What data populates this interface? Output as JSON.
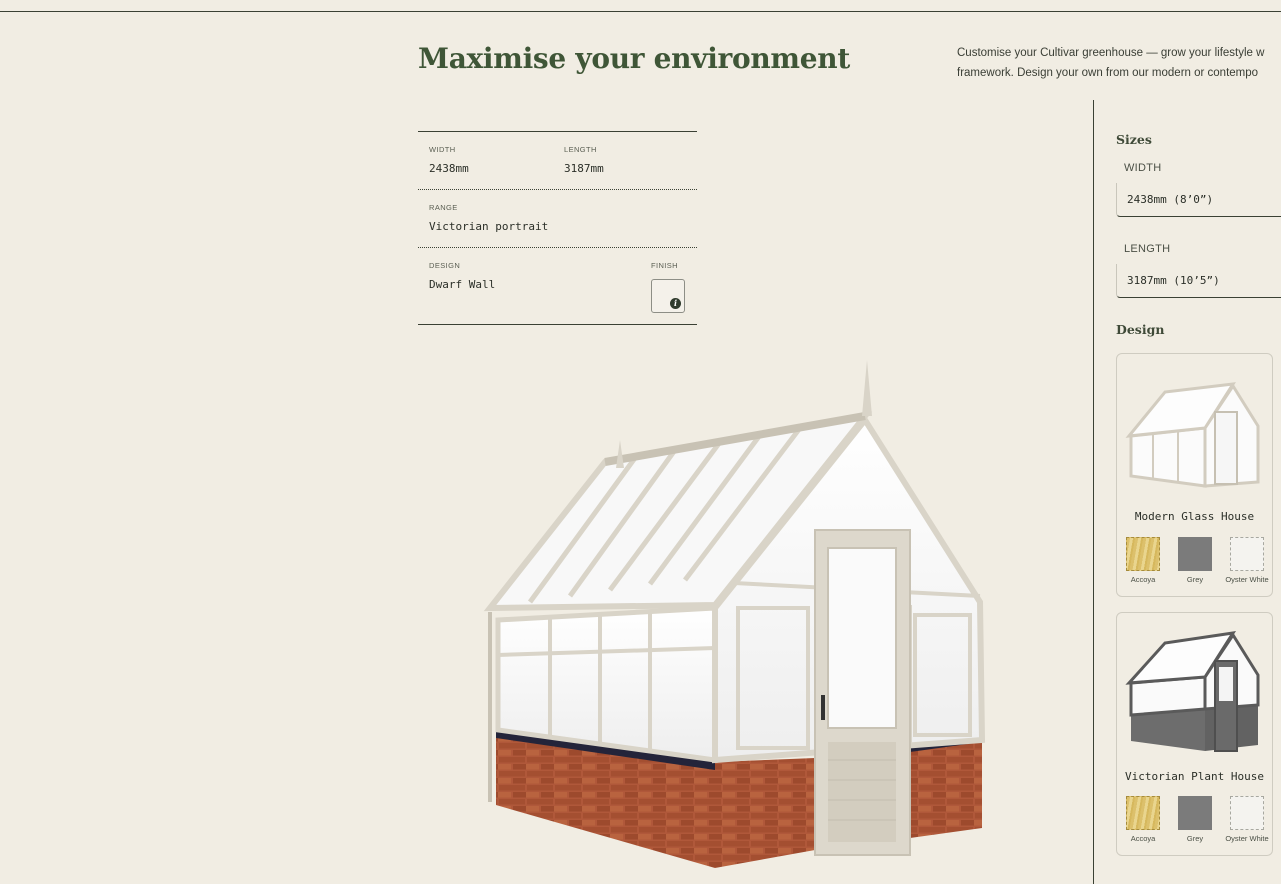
{
  "header": {
    "title": "Maximise your environment",
    "intro_line1": "Customise your Cultivar greenhouse — grow your lifestyle w",
    "intro_line2": "framework. Design your own from our modern or contempo"
  },
  "summary": {
    "width_label": "WIDTH",
    "width_value": "2438mm",
    "length_label": "LENGTH",
    "length_value": "3187mm",
    "range_label": "RANGE",
    "range_value": "Victorian portrait",
    "design_label": "DESIGN",
    "design_value": "Dwarf Wall",
    "finish_label": "FINISH",
    "finish_info_icon": "info-icon",
    "finish_info_glyph": "i"
  },
  "sizes": {
    "title": "Sizes",
    "width_label": "WIDTH",
    "width_value": "2438mm (8’0”)",
    "length_label": "LENGTH",
    "length_value": "3187mm (10’5”)"
  },
  "design": {
    "title": "Design",
    "cards": [
      {
        "name": "Modern Glass House",
        "image_icon": "greenhouse-cream-thumbnail",
        "finishes": [
          {
            "label": "Accoya",
            "color": "#dcc06b"
          },
          {
            "label": "Grey",
            "color": "#7b7b7b"
          },
          {
            "label": "Oyster White",
            "color": "#f4f3ef"
          }
        ]
      },
      {
        "name": "Victorian Plant House",
        "image_icon": "greenhouse-grey-thumbnail",
        "finishes": [
          {
            "label": "Accoya",
            "color": "#dcc06b"
          },
          {
            "label": "Grey",
            "color": "#7b7b7b"
          },
          {
            "label": "Oyster White",
            "color": "#f4f3ef"
          }
        ]
      }
    ]
  },
  "colors": {
    "background": "#f1ede3",
    "accent_green": "#3f5637",
    "frame_cream": "#ddd8cc",
    "brick": "#a9532e"
  }
}
